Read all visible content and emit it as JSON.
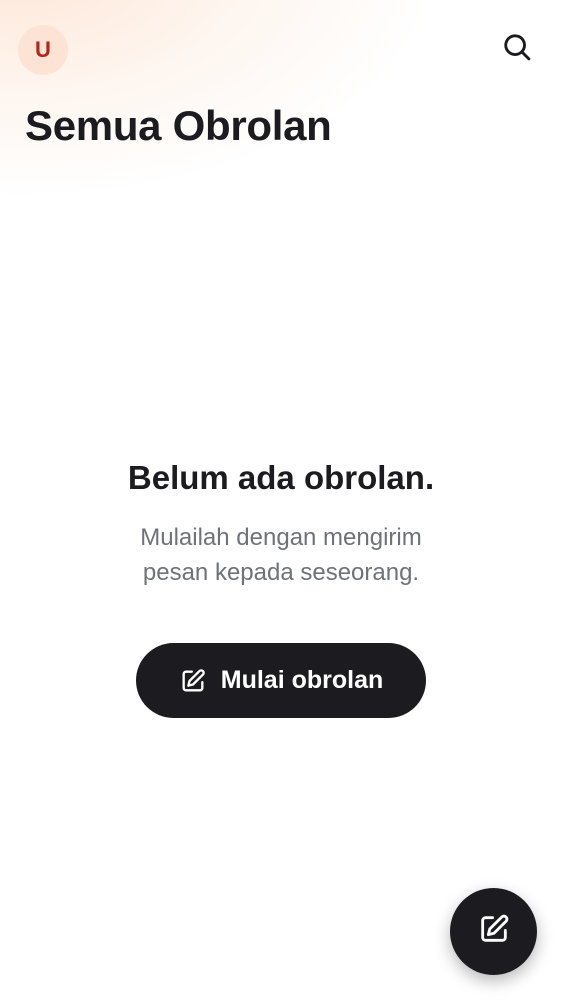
{
  "header": {
    "avatar_initial": "U",
    "title": "Semua Obrolan",
    "search_icon": "search-icon"
  },
  "empty_state": {
    "title": "Belum ada obrolan.",
    "description": "Mulailah dengan mengirim pesan kepada seseorang.",
    "button_label": "Mulai obrolan",
    "button_icon": "edit-icon"
  },
  "fab": {
    "icon": "edit-icon"
  },
  "colors": {
    "primary_dark": "#1c1c20",
    "avatar_bg": "#fde3d3",
    "avatar_text": "#b3261e",
    "muted_text": "#6f7278"
  }
}
